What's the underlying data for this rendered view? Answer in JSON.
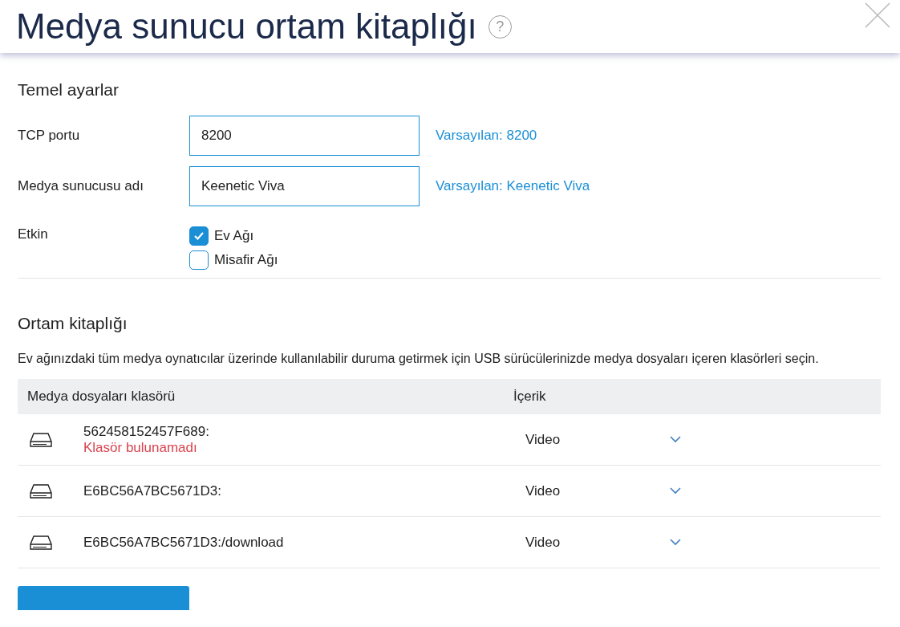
{
  "window": {
    "title": "Medya sunucu ortam kitaplığı",
    "help": "?"
  },
  "basic": {
    "heading": "Temel ayarlar",
    "fields": [
      {
        "label": "TCP portu",
        "value": "8200",
        "hint": "Varsayılan: 8200"
      },
      {
        "label": "Medya sunucusu adı",
        "value": "Keenetic Viva",
        "hint": "Varsayılan: Keenetic Viva"
      }
    ],
    "enabled": {
      "label": "Etkin",
      "options": [
        {
          "label": "Ev Ağı",
          "checked": true
        },
        {
          "label": "Misafir Ağı",
          "checked": false
        }
      ]
    }
  },
  "library": {
    "heading": "Ortam kitaplığı",
    "description": "Ev ağınızdaki tüm medya oynatıcılar üzerinde kullanılabilir duruma getirmek için USB sürücülerinizde medya dosyaları içeren klasörleri seçin.",
    "table": {
      "columns": [
        "Medya dosyaları klasörü",
        "İçerik"
      ],
      "rows": [
        {
          "folder": "562458152457F689:",
          "error": "Klasör bulunamadı",
          "content": "Video"
        },
        {
          "folder": "E6BC56A7BC5671D3:",
          "content": "Video"
        },
        {
          "folder": "E6BC56A7BC5671D3:/download",
          "content": "Video"
        }
      ]
    }
  }
}
